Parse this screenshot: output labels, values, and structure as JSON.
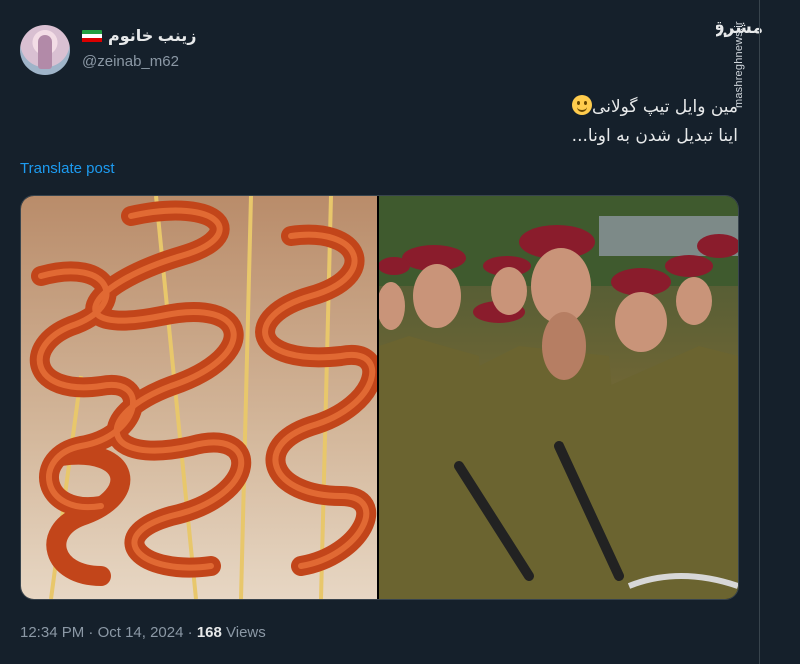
{
  "author": {
    "display_name": "زینب خانوم",
    "handle": "@zeinab_m62"
  },
  "tweet": {
    "line1": "مین وایل تیپ گولانی",
    "line2": "اینا تبدیل شدن به اونا..."
  },
  "translate_label": "Translate post",
  "meta": {
    "time": "12:34 PM",
    "separator": "·",
    "date": "Oct 14, 2024",
    "views_count": "168",
    "views_label": "Views"
  },
  "watermark": {
    "logo_text": "مشرق",
    "url": "mashreghnews.ir"
  },
  "colors": {
    "background": "#15202b",
    "link": "#1d9bf0",
    "secondary_text": "#8b98a5",
    "flag_green": "#239f40",
    "flag_white": "#ffffff",
    "flag_red": "#da0000"
  },
  "icons": {
    "avatar": "profile-photo",
    "flag": "iran-flag-icon",
    "emoji": "slightly-smiling-face-emoji"
  }
}
